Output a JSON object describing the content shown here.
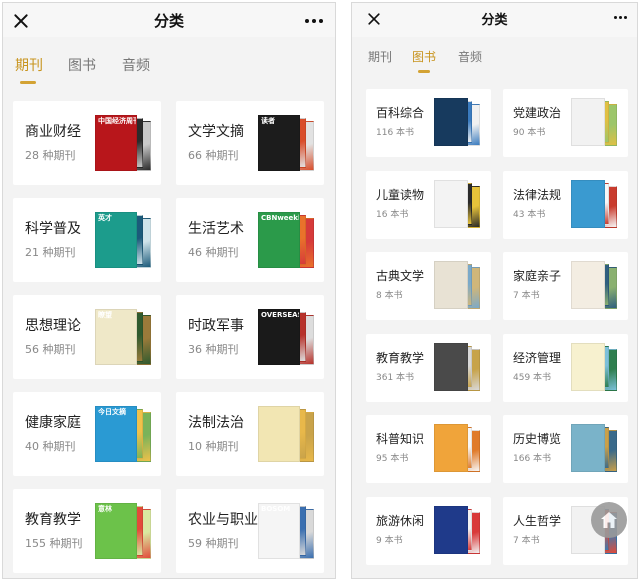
{
  "left": {
    "title": "分类",
    "tabs": [
      {
        "label": "期刊"
      },
      {
        "label": "图书"
      },
      {
        "label": "音频"
      }
    ],
    "active_tab": "期刊",
    "items": [
      {
        "name": "商业财经",
        "count": "28 种期刊",
        "cover_text": "中国经济周刊",
        "colors": [
          "#b8161b",
          "#2b2b2b",
          "#c9c9c9"
        ]
      },
      {
        "name": "文学文摘",
        "count": "66 种期刊",
        "cover_text": "读者",
        "colors": [
          "#1c1c1c",
          "#d94d2a",
          "#e2e2e2"
        ]
      },
      {
        "name": "科学普及",
        "count": "21 种期刊",
        "cover_text": "英才",
        "colors": [
          "#1c9c8c",
          "#1b5a7a",
          "#cfe3ea"
        ]
      },
      {
        "name": "生活艺术",
        "count": "46 种期刊",
        "cover_text": "CBNweekly",
        "colors": [
          "#2b9a4a",
          "#e9722b",
          "#d63a3a"
        ]
      },
      {
        "name": "思想理论",
        "count": "56 种期刊",
        "cover_text": "瞭望",
        "colors": [
          "#efe8c8",
          "#2f5a2e",
          "#9a7a3a"
        ]
      },
      {
        "name": "时政军事",
        "count": "36 种期刊",
        "cover_text": "OVERSEAS",
        "colors": [
          "#1a1a1a",
          "#b7322b",
          "#ddd"
        ]
      },
      {
        "name": "健康家庭",
        "count": "40 种期刊",
        "cover_text": "今日文摘",
        "colors": [
          "#2a9ad3",
          "#f0c14a",
          "#7ab35a"
        ]
      },
      {
        "name": "法制法治",
        "count": "10 种期刊",
        "cover_text": "",
        "colors": [
          "#f2e6b3",
          "#e8b84a",
          "#c9a34a"
        ]
      },
      {
        "name": "教育教学",
        "count": "155 种期刊",
        "cover_text": "意林",
        "colors": [
          "#6cc24a",
          "#e24b3a",
          "#d9e8a0"
        ]
      },
      {
        "name": "农业与职业",
        "count": "59 种期刊",
        "cover_text": "BOSOM",
        "colors": [
          "#f5f5f5",
          "#3a6fb0",
          "#d9d9d9"
        ]
      }
    ]
  },
  "right": {
    "title": "分类",
    "tabs": [
      {
        "label": "期刊"
      },
      {
        "label": "图书"
      },
      {
        "label": "音频"
      }
    ],
    "active_tab": "图书",
    "items": [
      {
        "name": "百科综合",
        "count": "116 本书",
        "colors": [
          "#173a5e",
          "#3a7bbf",
          "#f1f1f1"
        ]
      },
      {
        "name": "党建政治",
        "count": "90 本书",
        "colors": [
          "#f2f2f2",
          "#e0c044",
          "#9cc66a"
        ]
      },
      {
        "name": "儿童读物",
        "count": "16 本书",
        "colors": [
          "#f3f3f3",
          "#2a2a2a",
          "#e6c23a"
        ]
      },
      {
        "name": "法律法规",
        "count": "43 本书",
        "colors": [
          "#3a9ad0",
          "#f7f7f7",
          "#c93c2e"
        ]
      },
      {
        "name": "古典文学",
        "count": "8 本书",
        "colors": [
          "#e8e2d4",
          "#7aa9c9",
          "#cfb67a"
        ]
      },
      {
        "name": "家庭亲子",
        "count": "7 本书",
        "colors": [
          "#f3ede2",
          "#2f5f7f",
          "#8ab070"
        ]
      },
      {
        "name": "教育教学",
        "count": "361 本书",
        "colors": [
          "#4a4a4a",
          "#d9d9d9",
          "#c7a34a"
        ]
      },
      {
        "name": "经济管理",
        "count": "459 本书",
        "colors": [
          "#f7f1cf",
          "#7cc0d9",
          "#2f7f4f"
        ]
      },
      {
        "name": "科普知识",
        "count": "95 本书",
        "colors": [
          "#f0a43a",
          "#f7f7f7",
          "#e07b2a"
        ]
      },
      {
        "name": "历史博览",
        "count": "166 本书",
        "colors": [
          "#7ab3c9",
          "#c9a04a",
          "#3a6a8a"
        ]
      },
      {
        "name": "旅游休闲",
        "count": "9 本书",
        "colors": [
          "#1f3a8a",
          "#f2f2f2",
          "#d93a3a"
        ]
      },
      {
        "name": "人生哲学",
        "count": "7 本书",
        "colors": [
          "#f2f2f2",
          "#e24b3a",
          "#3a7ab0"
        ]
      }
    ]
  },
  "icons": {
    "close": "close-icon",
    "more": "more-icon",
    "home": "home-icon"
  }
}
